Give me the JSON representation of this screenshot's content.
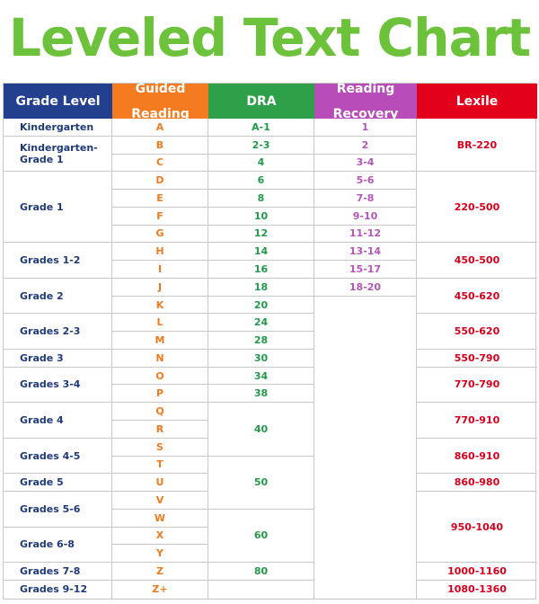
{
  "title": "Leveled Text Chart",
  "colors": {
    "title": "#6cc23a",
    "grade_header": "#23408f",
    "guided_header": "#f47b20",
    "dra_header": "#2ea04a",
    "recovery_header": "#b84cb8",
    "lexile_header": "#e3001b",
    "grade_text": "#1f3a7a",
    "guided_text": "#f07a1e",
    "dra_text": "#22994a",
    "recovery_text": "#b455b8",
    "lexile_text": "#d6001c"
  },
  "chart_data": {
    "type": "table",
    "title": "Leveled Text Chart",
    "columns": [
      "Grade Level",
      "Guided Reading",
      "DRA",
      "Reading Recovery",
      "Lexile"
    ],
    "header_lines": [
      [
        "Grade Level"
      ],
      [
        "Guided",
        "Reading"
      ],
      [
        "DRA"
      ],
      [
        "Reading",
        "Recovery"
      ],
      [
        "Lexile"
      ]
    ],
    "guided_reading": [
      "A",
      "B",
      "C",
      "D",
      "E",
      "F",
      "G",
      "H",
      "I",
      "J",
      "K",
      "L",
      "M",
      "N",
      "O",
      "P",
      "Q",
      "R",
      "S",
      "T",
      "U",
      "V",
      "W",
      "X",
      "Y",
      "Z",
      "Z+"
    ],
    "grade_level": [
      {
        "label": "Kindergarten",
        "start": 0,
        "span": 1
      },
      {
        "label": "Kindergarten-\nGrade 1",
        "start": 1,
        "span": 2
      },
      {
        "label": "Grade 1",
        "start": 3,
        "span": 4
      },
      {
        "label": "Grades 1-2",
        "start": 7,
        "span": 2
      },
      {
        "label": "Grade 2",
        "start": 9,
        "span": 2
      },
      {
        "label": "Grades 2-3",
        "start": 11,
        "span": 2
      },
      {
        "label": "Grade 3",
        "start": 13,
        "span": 1
      },
      {
        "label": "Grades 3-4",
        "start": 14,
        "span": 2
      },
      {
        "label": "Grade 4",
        "start": 16,
        "span": 2
      },
      {
        "label": "Grades 4-5",
        "start": 18,
        "span": 2
      },
      {
        "label": "Grade 5",
        "start": 20,
        "span": 1
      },
      {
        "label": "Grades 5-6",
        "start": 21,
        "span": 2
      },
      {
        "label": "Grade 6-8",
        "start": 23,
        "span": 2
      },
      {
        "label": "Grades 7-8",
        "start": 25,
        "span": 1
      },
      {
        "label": "Grades 9-12",
        "start": 26,
        "span": 1
      }
    ],
    "dra": [
      {
        "label": "A-1",
        "start": 0,
        "span": 1
      },
      {
        "label": "2-3",
        "start": 1,
        "span": 1
      },
      {
        "label": "4",
        "start": 2,
        "span": 1
      },
      {
        "label": "6",
        "start": 3,
        "span": 1
      },
      {
        "label": "8",
        "start": 4,
        "span": 1
      },
      {
        "label": "10",
        "start": 5,
        "span": 1
      },
      {
        "label": "12",
        "start": 6,
        "span": 1
      },
      {
        "label": "14",
        "start": 7,
        "span": 1
      },
      {
        "label": "16",
        "start": 8,
        "span": 1
      },
      {
        "label": "18",
        "start": 9,
        "span": 1
      },
      {
        "label": "20",
        "start": 10,
        "span": 1
      },
      {
        "label": "24",
        "start": 11,
        "span": 1
      },
      {
        "label": "28",
        "start": 12,
        "span": 1
      },
      {
        "label": "30",
        "start": 13,
        "span": 1
      },
      {
        "label": "34",
        "start": 14,
        "span": 1
      },
      {
        "label": "38",
        "start": 15,
        "span": 1
      },
      {
        "label": "40",
        "start": 16,
        "span": 3
      },
      {
        "label": "50",
        "start": 19,
        "span": 3
      },
      {
        "label": "60",
        "start": 22,
        "span": 3
      },
      {
        "label": "80",
        "start": 25,
        "span": 1
      },
      {
        "label": "",
        "start": 26,
        "span": 1
      }
    ],
    "reading_recovery": [
      {
        "label": "1",
        "start": 0,
        "span": 1
      },
      {
        "label": "2",
        "start": 1,
        "span": 1
      },
      {
        "label": "3-4",
        "start": 2,
        "span": 1
      },
      {
        "label": "5-6",
        "start": 3,
        "span": 1
      },
      {
        "label": "7-8",
        "start": 4,
        "span": 1
      },
      {
        "label": "9-10",
        "start": 5,
        "span": 1
      },
      {
        "label": "11-12",
        "start": 6,
        "span": 1
      },
      {
        "label": "13-14",
        "start": 7,
        "span": 1
      },
      {
        "label": "15-17",
        "start": 8,
        "span": 1
      },
      {
        "label": "18-20",
        "start": 9,
        "span": 1
      },
      {
        "label": "",
        "start": 10,
        "span": 17
      }
    ],
    "lexile": [
      {
        "label": "BR-220",
        "start": 0,
        "span": 3
      },
      {
        "label": "220-500",
        "start": 3,
        "span": 4
      },
      {
        "label": "450-500",
        "start": 7,
        "span": 2
      },
      {
        "label": "450-620",
        "start": 9,
        "span": 2
      },
      {
        "label": "550-620",
        "start": 11,
        "span": 2
      },
      {
        "label": "550-790",
        "start": 13,
        "span": 1
      },
      {
        "label": "770-790",
        "start": 14,
        "span": 2
      },
      {
        "label": "770-910",
        "start": 16,
        "span": 2
      },
      {
        "label": "860-910",
        "start": 18,
        "span": 2
      },
      {
        "label": "860-980",
        "start": 20,
        "span": 1
      },
      {
        "label": "950-1040",
        "start": 21,
        "span": 4
      },
      {
        "label": "1000-1160",
        "start": 25,
        "span": 1
      },
      {
        "label": "1080-1360",
        "start": 26,
        "span": 1
      }
    ]
  }
}
